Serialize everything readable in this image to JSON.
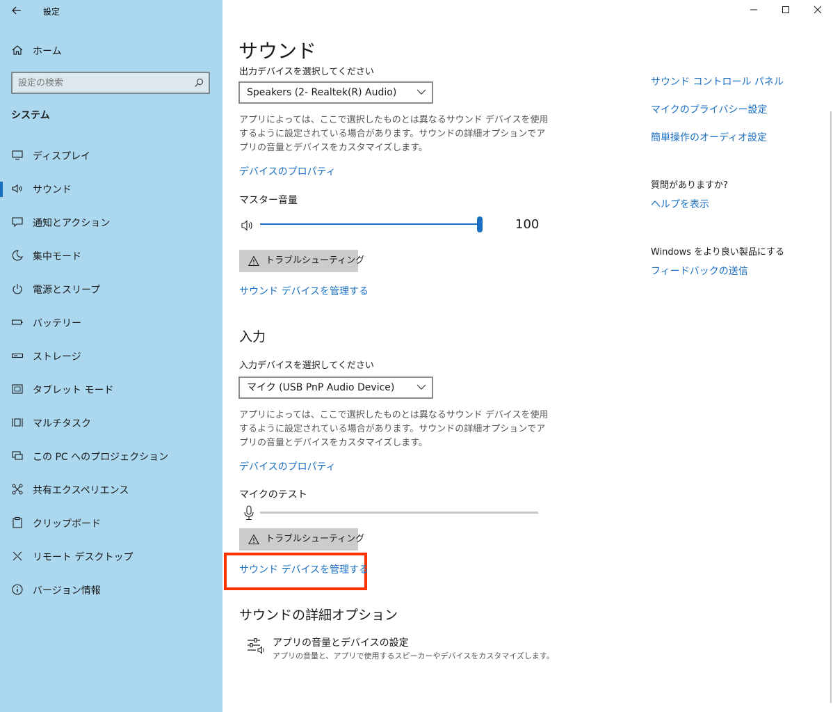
{
  "window": {
    "title": "設定"
  },
  "sidebar": {
    "home_label": "ホーム",
    "search_placeholder": "設定の検索",
    "section_heading": "システム",
    "items": [
      {
        "label": "ディスプレイ",
        "icon": "display-icon"
      },
      {
        "label": "サウンド",
        "icon": "speaker-icon",
        "selected": true
      },
      {
        "label": "通知とアクション",
        "icon": "notification-icon"
      },
      {
        "label": "集中モード",
        "icon": "moon-icon"
      },
      {
        "label": "電源とスリープ",
        "icon": "power-icon"
      },
      {
        "label": "バッテリー",
        "icon": "battery-icon"
      },
      {
        "label": "ストレージ",
        "icon": "storage-icon"
      },
      {
        "label": "タブレット モード",
        "icon": "tablet-icon"
      },
      {
        "label": "マルチタスク",
        "icon": "multitask-icon"
      },
      {
        "label": "この PC へのプロジェクション",
        "icon": "projection-icon"
      },
      {
        "label": "共有エクスペリエンス",
        "icon": "share-icon"
      },
      {
        "label": "クリップボード",
        "icon": "clipboard-icon"
      },
      {
        "label": "リモート デスクトップ",
        "icon": "remote-icon"
      },
      {
        "label": "バージョン情報",
        "icon": "info-icon"
      }
    ]
  },
  "main": {
    "page_title": "サウンド",
    "output": {
      "select_label": "出力デバイスを選択してください",
      "selected_device": "Speakers (2- Realtek(R) Audio)",
      "description": "アプリによっては、ここで選択したものとは異なるサウンド デバイスを使用するように設定されている場合があります。サウンドの詳細オプションでアプリの音量とデバイスをカスタマイズします。",
      "properties_link": "デバイスのプロパティ",
      "volume_label": "マスター音量",
      "volume_value": "100",
      "volume_level": 100,
      "troubleshoot_label": "トラブルシューティング",
      "manage_link": "サウンド デバイスを管理する"
    },
    "input": {
      "section_title": "入力",
      "select_label": "入力デバイスを選択してください",
      "selected_device": "マイク (USB PnP Audio Device)",
      "description": "アプリによっては、ここで選択したものとは異なるサウンド デバイスを使用するように設定されている場合があります。サウンドの詳細オプションでアプリの音量とデバイスをカスタマイズします。",
      "properties_link": "デバイスのプロパティ",
      "mic_test_label": "マイクのテスト",
      "troubleshoot_label": "トラブルシューティング",
      "manage_link": "サウンド デバイスを管理する"
    },
    "advanced": {
      "section_title": "サウンドの詳細オプション",
      "item_title": "アプリの音量とデバイスの設定",
      "item_desc": "アプリの音量と、アプリで使用するスピーカーやデバイスをカスタマイズします。"
    }
  },
  "related": {
    "links": [
      "サウンド コントロール パネル",
      "マイクのプライバシー設定",
      "簡単操作のオーディオ設定"
    ],
    "help_heading": "質問がありますか?",
    "help_link": "ヘルプを表示",
    "feedback_heading": "Windows をより良い製品にする",
    "feedback_link": "フィードバックの送信"
  },
  "colors": {
    "accent": "#1a6fc2",
    "sidebar_bg": "#acd8ef",
    "highlight": "#ff3300"
  }
}
